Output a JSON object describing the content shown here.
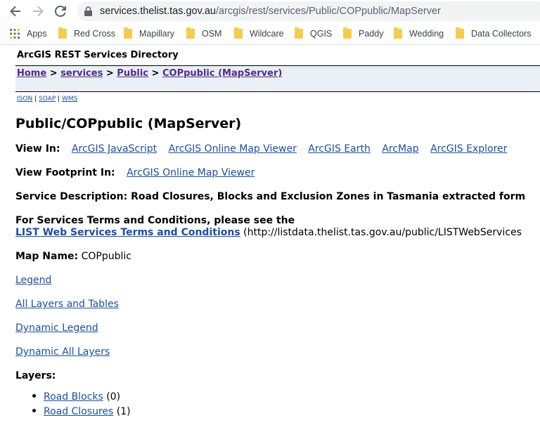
{
  "browser": {
    "url_host": "services.thelist.tas.gov.au",
    "url_path": "/arcgis/rest/services/Public/COPpublic/MapServer",
    "bookmarks": [
      "Apps",
      "Red Cross",
      "Mapillary",
      "OSM",
      "Wildcare",
      "QGIS",
      "Paddy",
      "Wedding",
      "Data Collectors"
    ]
  },
  "page": {
    "directory_title": "ArcGIS REST Services Directory",
    "breadcrumbs": [
      "Home",
      "services",
      "Public",
      "COPpublic (MapServer)"
    ],
    "breadcrumb_sep": ">",
    "formats": [
      "JSON",
      "SOAP",
      "WMS"
    ],
    "format_sep": "|",
    "heading": "Public/COPpublic (MapServer)",
    "view_in_label": "View In:",
    "view_in_links": [
      "ArcGIS JavaScript",
      "ArcGIS Online Map Viewer",
      "ArcGIS Earth",
      "ArcMap",
      "ArcGIS Explorer"
    ],
    "footprint_label": "View Footprint In:",
    "footprint_link": "ArcGIS Online Map Viewer",
    "service_desc": "Service Description: Road Closures, Blocks and Exclusion Zones in Tasmania extracted form",
    "terms_line": "For Services Terms and Conditions, please see the",
    "terms_link": "LIST Web Services Terms and Conditions",
    "terms_url": "(http://listdata.thelist.tas.gov.au/public/LISTWebServices",
    "map_name_label": "Map Name:",
    "map_name_value": "COPpublic",
    "links": [
      "Legend",
      "All Layers and Tables",
      "Dynamic Legend",
      "Dynamic All Layers"
    ],
    "layers_label": "Layers:",
    "layers": [
      {
        "name": "Road Blocks",
        "count": "(0)"
      },
      {
        "name": "Road Closures",
        "count": "(1)"
      }
    ]
  }
}
